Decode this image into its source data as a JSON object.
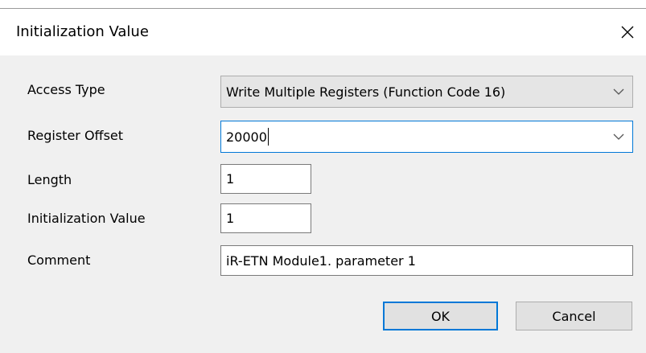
{
  "dialog": {
    "title": "Initialization Value",
    "close_icon": "close-icon"
  },
  "form": {
    "access_type": {
      "label": "Access Type",
      "value": "Write Multiple Registers (Function Code 16)"
    },
    "register_offset": {
      "label": "Register Offset",
      "value": "20000"
    },
    "length": {
      "label": "Length",
      "value": "1"
    },
    "initialization_value": {
      "label": "Initialization Value",
      "value": "1"
    },
    "comment": {
      "label": "Comment",
      "value": "iR-ETN Module1. parameter 1"
    }
  },
  "buttons": {
    "ok": "OK",
    "cancel": "Cancel"
  },
  "colors": {
    "accent": "#0078d7",
    "dialog_bg": "#f0f0f0"
  }
}
